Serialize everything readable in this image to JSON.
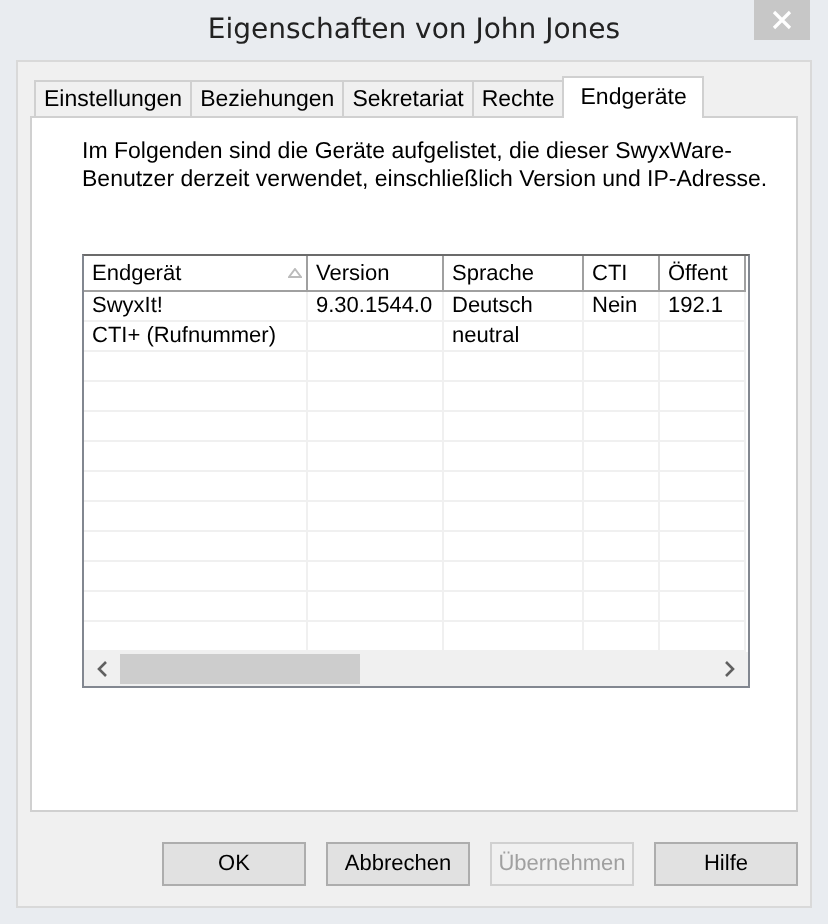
{
  "window": {
    "title": "Eigenschaften von John Jones"
  },
  "tabs": [
    {
      "label": "Einstellungen",
      "selected": false
    },
    {
      "label": "Beziehungen",
      "selected": false
    },
    {
      "label": "Sekretariat",
      "selected": false
    },
    {
      "label": "Rechte",
      "selected": false
    },
    {
      "label": "Endgeräte",
      "selected": true
    }
  ],
  "description": "Im Folgenden sind die Geräte aufgelistet, die dieser SwyxWare-Benutzer derzeit verwendet, einschließlich Version und IP-Adresse.",
  "table": {
    "columns": [
      {
        "label": "Endgerät",
        "sorted": true
      },
      {
        "label": "Version",
        "sorted": false
      },
      {
        "label": "Sprache",
        "sorted": false
      },
      {
        "label": "CTI",
        "sorted": false
      },
      {
        "label": "Öffent",
        "sorted": false
      }
    ],
    "rows": [
      [
        "SwyxIt!",
        "9.30.1544.0",
        "Deutsch",
        "Nein",
        "192.1"
      ],
      [
        "CTI+ (Rufnummer)",
        "",
        "neutral",
        "",
        ""
      ]
    ]
  },
  "buttons": [
    {
      "label": "OK",
      "disabled": false
    },
    {
      "label": "Abbrechen",
      "disabled": false
    },
    {
      "label": "Übernehmen",
      "disabled": true
    },
    {
      "label": "Hilfe",
      "disabled": false
    }
  ]
}
